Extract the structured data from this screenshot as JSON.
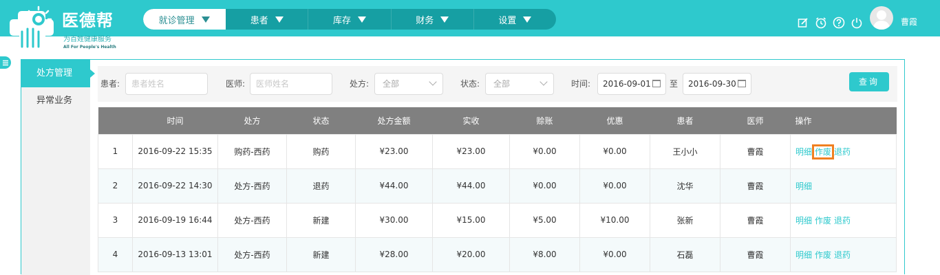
{
  "brand": {
    "name": "医德帮",
    "subtitle": "为百姓健康服务",
    "english": "All For People's Health"
  },
  "nav": {
    "items": [
      {
        "label": "就诊管理",
        "active": true
      },
      {
        "label": "患者",
        "active": false
      },
      {
        "label": "库存",
        "active": false
      },
      {
        "label": "财务",
        "active": false
      },
      {
        "label": "设置",
        "active": false
      }
    ]
  },
  "header": {
    "icons": [
      "edit-icon",
      "clock-icon",
      "help-icon",
      "power-icon"
    ],
    "username": "曹霞"
  },
  "side_menu": {
    "items": [
      {
        "label": "处方管理",
        "active": true
      },
      {
        "label": "异常业务",
        "active": false
      }
    ]
  },
  "filters": {
    "patient_label": "患者:",
    "patient_placeholder": "患者姓名",
    "doctor_label": "医师:",
    "doctor_placeholder": "医师姓名",
    "rx_label": "处方:",
    "rx_value": "全部",
    "status_label": "状态:",
    "status_value": "全部",
    "time_label": "时间:",
    "date_from": "2016-09-01",
    "to_label": "至",
    "date_to": "2016-09-30",
    "query_button": "查询"
  },
  "table": {
    "columns": [
      "",
      "时间",
      "处方",
      "状态",
      "处方金额",
      "实收",
      "赊账",
      "优惠",
      "患者",
      "医师",
      "操作"
    ],
    "rows": [
      {
        "no": "1",
        "time": "2016-09-22 15:35",
        "rx": "购药-西药",
        "status": "购药",
        "amount": "¥23.00",
        "received": "¥23.00",
        "credit": "¥0.00",
        "discount": "¥0.00",
        "patient": "王小小",
        "doctor": "曹霞",
        "ops": [
          "明细",
          "作废",
          "退药"
        ]
      },
      {
        "no": "2",
        "time": "2016-09-22 14:30",
        "rx": "处方-西药",
        "status": "退药",
        "amount": "¥44.00",
        "received": "¥44.00",
        "credit": "¥0.00",
        "discount": "¥0.00",
        "patient": "沈华",
        "doctor": "曹霞",
        "ops": [
          "明细"
        ]
      },
      {
        "no": "3",
        "time": "2016-09-19 16:44",
        "rx": "处方-西药",
        "status": "新建",
        "amount": "¥30.00",
        "received": "¥15.00",
        "credit": "¥5.00",
        "discount": "¥10.00",
        "patient": "张新",
        "doctor": "曹霞",
        "ops": [
          "明细",
          "作废",
          "退药"
        ]
      },
      {
        "no": "4",
        "time": "2016-09-13 13:01",
        "rx": "处方-西药",
        "status": "新建",
        "amount": "¥28.00",
        "received": "¥20.00",
        "credit": "¥8.00",
        "discount": "¥0.00",
        "patient": "石磊",
        "doctor": "曹霞",
        "ops": [
          "明细",
          "作废",
          "退药"
        ]
      }
    ]
  },
  "colors": {
    "accent": "#2ec9cd",
    "nav_dark": "#169fa3",
    "table_header": "#808080",
    "highlight": "#f08020"
  }
}
